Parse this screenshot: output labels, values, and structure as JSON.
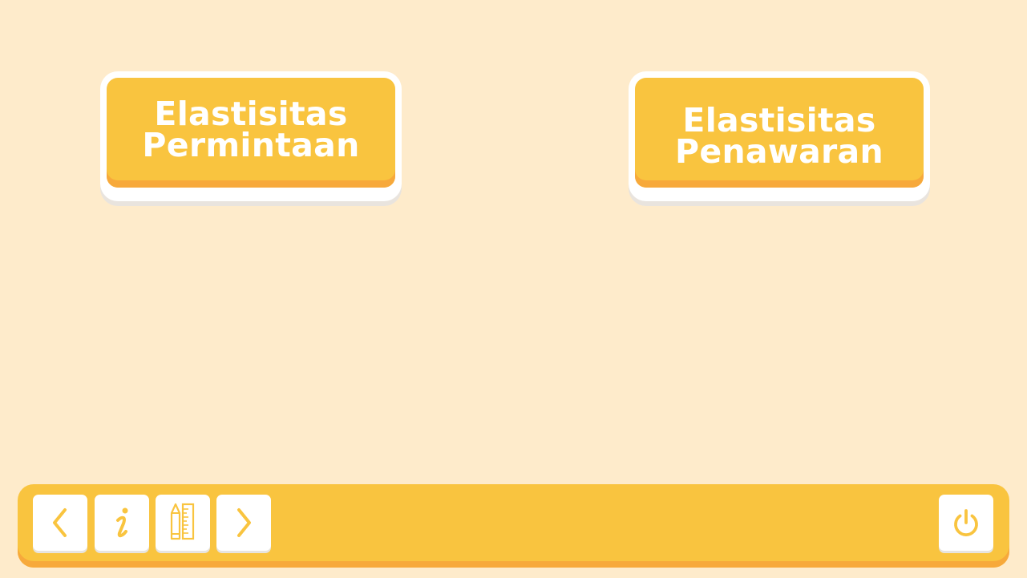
{
  "menu": {
    "demand": {
      "line1": "Elastisitas",
      "line2": "Permintaan"
    },
    "supply": {
      "line1": "Elastisitas",
      "line2": "Penawaran"
    }
  },
  "toolbar": {
    "buttons": [
      {
        "id": "prev",
        "icon": "chevron-left-icon"
      },
      {
        "id": "info",
        "icon": "info-icon"
      },
      {
        "id": "tools",
        "icon": "pencil-ruler-icon"
      },
      {
        "id": "next",
        "icon": "chevron-right-icon"
      },
      {
        "id": "power",
        "icon": "power-icon"
      }
    ]
  },
  "colors": {
    "background": "#FEEBCB",
    "accent": "#F9C43F",
    "accent_shadow": "#F7A93B",
    "tile": "#FFFFFF"
  }
}
